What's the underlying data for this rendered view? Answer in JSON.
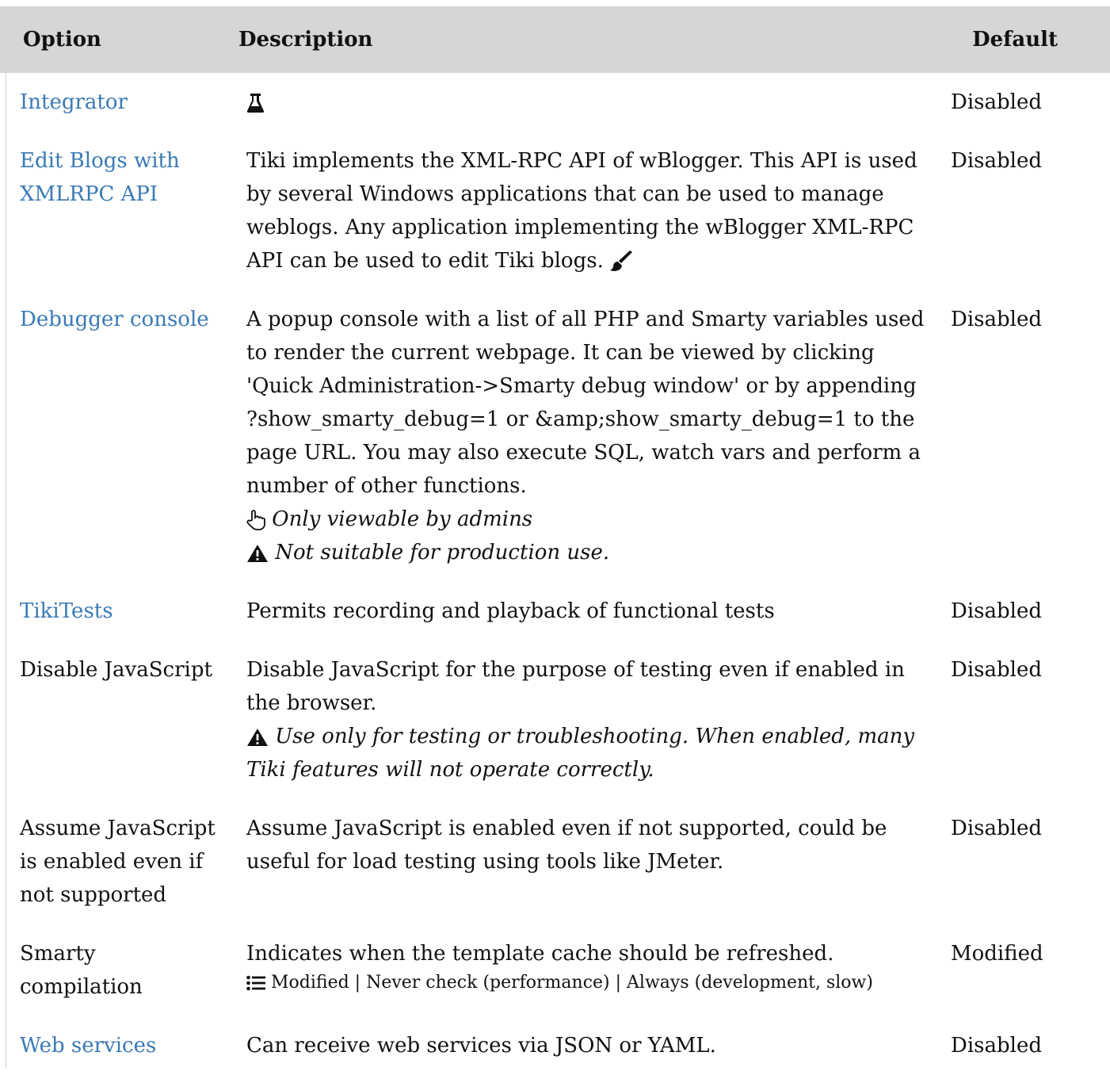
{
  "header": {
    "option": "Option",
    "description": "Description",
    "default": "Default"
  },
  "rows": [
    {
      "option": "Integrator",
      "option_is_link": true,
      "description": "",
      "description_icon": "flask-icon",
      "default": "Disabled"
    },
    {
      "option": "Edit Blogs with XMLRPC API",
      "option_is_link": true,
      "description": "Tiki implements the XML-RPC API of wBlogger. This API is used by several Windows applications that can be used to manage weblogs. Any application implementing the wBlogger XML-RPC API can be used to edit Tiki blogs.",
      "description_icon": "paint-brush-icon",
      "default": "Disabled"
    },
    {
      "option": "Debugger console",
      "option_is_link": true,
      "description": "A popup console with a list of all PHP and Smarty variables used to render the current webpage. It can be viewed by clicking 'Quick Administration->Smarty debug window' or by appending ?show_smarty_debug=1 or &amp;show_smarty_debug=1 to the page URL. You may also execute SQL, watch vars and perform a number of other functions.",
      "notes": [
        {
          "icon": "pointer-hand-icon",
          "text": "Only viewable by admins"
        },
        {
          "icon": "warning-icon",
          "text": "Not suitable for production use."
        }
      ],
      "default": "Disabled"
    },
    {
      "option": "TikiTests",
      "option_is_link": true,
      "description": "Permits recording and playback of functional tests",
      "default": "Disabled"
    },
    {
      "option": "Disable JavaScript",
      "option_is_link": false,
      "description": "Disable JavaScript for the purpose of testing even if enabled in the browser.",
      "notes": [
        {
          "icon": "warning-icon",
          "text": "Use only for testing or troubleshooting. When enabled, many Tiki features will not operate correctly."
        }
      ],
      "default": "Disabled"
    },
    {
      "option": "Assume JavaScript is enabled even if not supported",
      "option_is_link": false,
      "description": "Assume JavaScript is enabled even if not supported, could be useful for load testing using tools like JMeter.",
      "default": "Disabled"
    },
    {
      "option": "Smarty compilation",
      "option_is_link": false,
      "description": "Indicates when the template cache should be refreshed.",
      "options_line": {
        "icon": "list-icon",
        "text": "Modified | Never check (performance) | Always (development, slow)"
      },
      "default": "Modified"
    },
    {
      "option": "Web services",
      "option_is_link": true,
      "description": "Can receive web services via JSON or YAML.",
      "default": "Disabled"
    }
  ]
}
